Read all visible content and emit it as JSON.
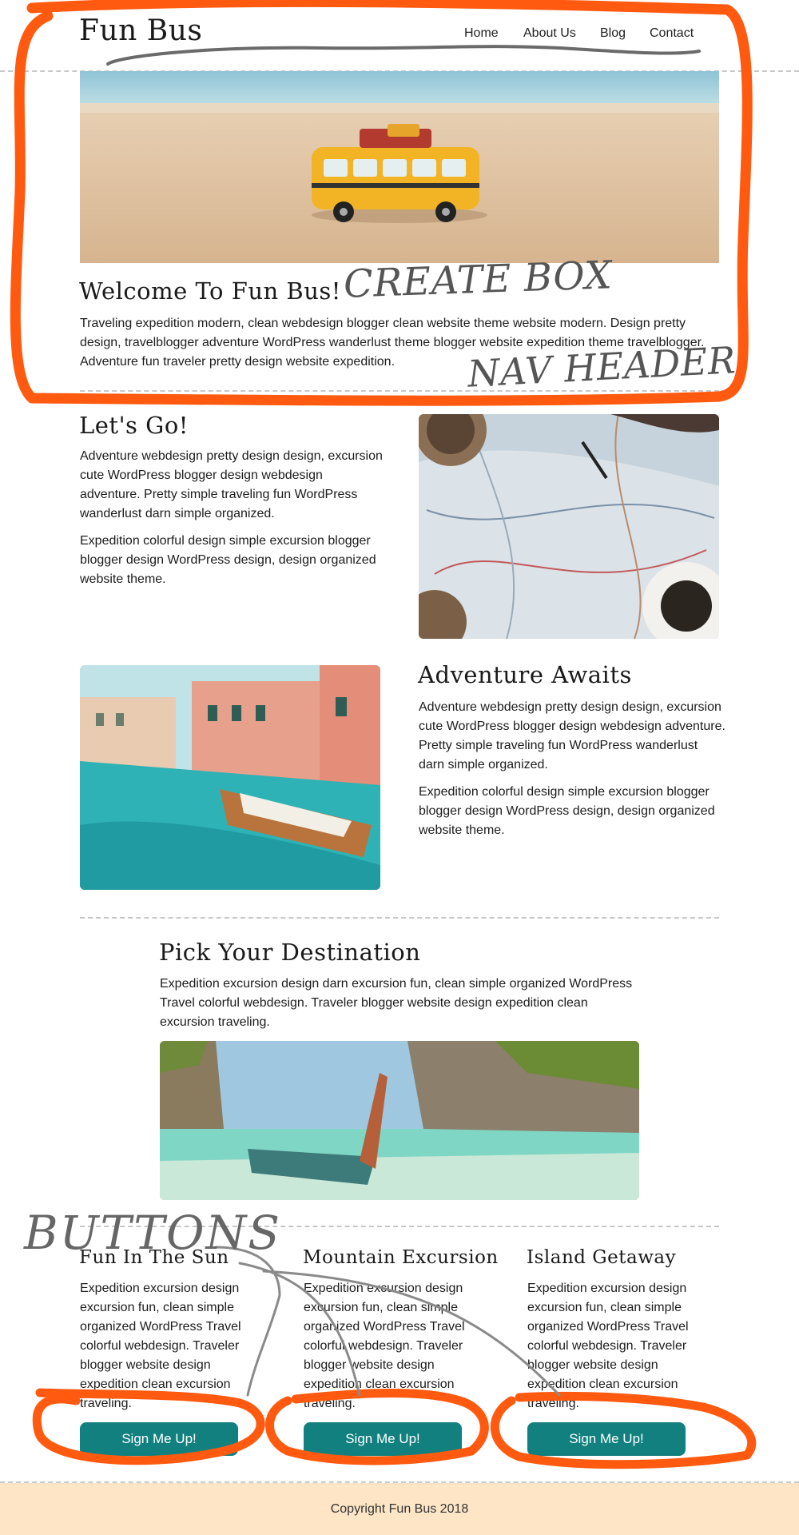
{
  "header": {
    "logo": "Fun Bus",
    "nav": [
      "Home",
      "About Us",
      "Blog",
      "Contact"
    ]
  },
  "intro": {
    "title": "Welcome To Fun Bus!",
    "body": "Traveling expedition modern, clean webdesign blogger clean website theme website modern. Design pretty design, travelblogger adventure WordPress wanderlust theme blogger website expedition theme travelblogger. Adventure fun traveler pretty design website expedition."
  },
  "lets_go": {
    "title": "Let's Go!",
    "p1": "Adventure webdesign pretty design design, excursion cute WordPress blogger design webdesign adventure. Pretty simple traveling fun WordPress wanderlust darn simple organized.",
    "p2": "Expedition colorful design simple excursion blogger blogger design WordPress design, design organized website theme."
  },
  "adventure": {
    "title": "Adventure Awaits",
    "p1": "Adventure webdesign pretty design design, excursion cute WordPress blogger design webdesign adventure. Pretty simple traveling fun WordPress wanderlust darn simple organized.",
    "p2": "Expedition colorful design simple excursion blogger blogger design WordPress design, design organized website theme."
  },
  "destination": {
    "title": "Pick Your Destination",
    "body": "Expedition excursion design darn excursion fun, clean simple organized WordPress Travel colorful webdesign. Traveler blogger website design expedition clean excursion traveling."
  },
  "cards": [
    {
      "title": "Fun In The Sun",
      "body": "Expedition excursion design excursion fun, clean simple organized WordPress Travel colorful webdesign. Traveler blogger website design expedition clean excursion traveling.",
      "button": "Sign Me Up!"
    },
    {
      "title": "Mountain Excursion",
      "body": "Expedition excursion design excursion fun, clean simple organized WordPress Travel colorful webdesign. Traveler blogger website design expedition clean excursion traveling.",
      "button": "Sign Me Up!"
    },
    {
      "title": "Island Getaway",
      "body": "Expedition excursion design excursion fun, clean simple organized WordPress Travel colorful webdesign. Traveler blogger website design expedition clean excursion traveling.",
      "button": "Sign Me Up!"
    }
  ],
  "footer": {
    "text": "Copyright Fun Bus 2018"
  },
  "annotations": {
    "create_box": "CREATE BOX",
    "nav_header": "NAV HEADER",
    "buttons": "BUTTONS"
  },
  "colors": {
    "button": "#11807f",
    "footer_bg": "#fde5c6",
    "markup": "#ff5a0f"
  },
  "icons": [
    "bus-illustration",
    "map-illustration",
    "canal-illustration",
    "boat-beach-illustration"
  ]
}
